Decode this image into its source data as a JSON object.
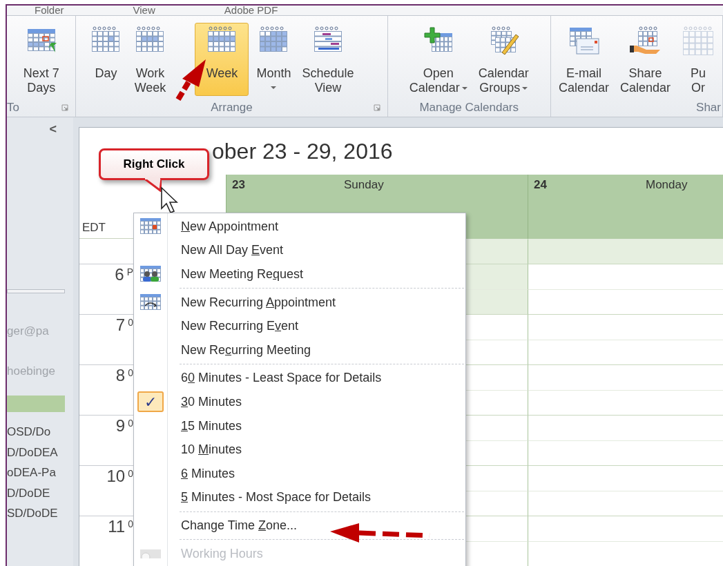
{
  "tabs": [
    {
      "label": "Folder"
    },
    {
      "label": "View"
    },
    {
      "label": "Adobe PDF"
    }
  ],
  "ribbon": {
    "groups": [
      {
        "label": "To",
        "launcher": true,
        "buttons": [
          {
            "lines": [
              "Next 7",
              "Days"
            ],
            "selected": false,
            "dropdown": false
          }
        ]
      },
      {
        "label": "Arrange",
        "launcher": true,
        "buttons": [
          {
            "lines": [
              "Day"
            ],
            "selected": false,
            "dropdown": false
          },
          {
            "lines": [
              "Work",
              "Week"
            ],
            "selected": false,
            "dropdown": false
          },
          {
            "lines": [
              "Week"
            ],
            "selected": true,
            "dropdown": false
          },
          {
            "lines": [
              "Month"
            ],
            "selected": false,
            "dropdown": true
          },
          {
            "lines": [
              "Schedule",
              "View"
            ],
            "selected": false,
            "dropdown": false
          }
        ]
      },
      {
        "label": "Manage Calendars",
        "launcher": false,
        "buttons": [
          {
            "lines": [
              "Open",
              "Calendar"
            ],
            "selected": false,
            "dropdown": true
          },
          {
            "lines": [
              "Calendar",
              "Groups"
            ],
            "selected": false,
            "dropdown": true
          }
        ]
      },
      {
        "label": "Shar",
        "launcher": false,
        "buttons": [
          {
            "lines": [
              "E-mail",
              "Calendar"
            ],
            "selected": false,
            "dropdown": false
          },
          {
            "lines": [
              "Share",
              "Calendar"
            ],
            "selected": false,
            "dropdown": false
          },
          {
            "lines": [
              "Pu",
              "Or"
            ],
            "selected": false,
            "dropdown": false
          }
        ]
      }
    ]
  },
  "sidebar": {
    "collapse": "<",
    "items": [
      {
        "kind": "faded",
        "text": "ger@pa"
      },
      {
        "kind": "faded",
        "text": "hoebinge"
      },
      {
        "kind": "highlight"
      },
      {
        "kind": "folder",
        "text": "OSD/Do"
      },
      {
        "kind": "folder",
        "text": "D/DoDEA"
      },
      {
        "kind": "folder",
        "text": "oDEA-Pa"
      },
      {
        "kind": "folder",
        "text": "D/DoDE"
      },
      {
        "kind": "folder",
        "text": "SD/DoDE"
      }
    ]
  },
  "calendar": {
    "title": "ober 23 - 29, 2016",
    "timezone": "EDT",
    "days": [
      {
        "number": "23",
        "name": "Sunday"
      },
      {
        "number": "24",
        "name": "Monday"
      }
    ],
    "slots": [
      {
        "shaded": [
          true,
          true
        ]
      },
      {
        "hour": "6",
        "sup": "P",
        "shaded": [
          true,
          false
        ]
      },
      {
        "shaded": [
          true,
          false
        ]
      },
      {
        "hour": "7",
        "sup": "0",
        "shaded": [
          false,
          false
        ]
      },
      {
        "shaded": [
          false,
          false
        ]
      },
      {
        "hour": "8",
        "sup": "0",
        "shaded": [
          false,
          false
        ]
      },
      {
        "shaded": [
          false,
          false
        ]
      },
      {
        "hour": "9",
        "sup": "0",
        "shaded": [
          false,
          false
        ]
      },
      {
        "shaded": [
          false,
          false
        ]
      },
      {
        "hour": "10",
        "sup": "0",
        "shaded": [
          false,
          false
        ]
      },
      {
        "shaded": [
          false,
          false
        ]
      },
      {
        "hour": "11",
        "sup": "0",
        "shaded": [
          false,
          false
        ]
      },
      {
        "shaded": [
          false,
          false
        ]
      }
    ]
  },
  "callout": {
    "text": "Right Click"
  },
  "context_menu": {
    "check_mark": "✓",
    "items": [
      {
        "kind": "item",
        "label": {
          "key": "N",
          "post": "ew Appointment"
        },
        "checked": false,
        "disabled": false
      },
      {
        "kind": "item",
        "label": {
          "pre": "New All Day ",
          "key": "E",
          "post": "vent"
        },
        "checked": false,
        "disabled": false
      },
      {
        "kind": "item",
        "label": {
          "pre": "New Meeting Re",
          "key": "q",
          "post": "uest"
        },
        "checked": false,
        "disabled": false
      },
      {
        "kind": "separator"
      },
      {
        "kind": "item",
        "label": {
          "pre": "New Recurring ",
          "key": "A",
          "post": "ppointment"
        },
        "checked": false,
        "disabled": false
      },
      {
        "kind": "item",
        "label": {
          "pre": "New Recurring E",
          "key": "v",
          "post": "ent"
        },
        "checked": false,
        "disabled": false
      },
      {
        "kind": "item",
        "label": {
          "pre": "New Re",
          "key": "c",
          "post": "urring Meeting"
        },
        "checked": false,
        "disabled": false
      },
      {
        "kind": "separator"
      },
      {
        "kind": "item",
        "label": {
          "pre": "6",
          "key": "0",
          "post": " Minutes - Least Space for Details"
        },
        "checked": false,
        "disabled": false
      },
      {
        "kind": "item",
        "label": {
          "key": "3",
          "post": "0 Minutes"
        },
        "checked": true,
        "disabled": false
      },
      {
        "kind": "item",
        "label": {
          "key": "1",
          "post": "5 Minutes"
        },
        "checked": false,
        "disabled": false
      },
      {
        "kind": "item",
        "label": {
          "pre": "10 ",
          "key": "M",
          "post": "inutes"
        },
        "checked": false,
        "disabled": false
      },
      {
        "kind": "item",
        "label": {
          "key": "6",
          "post": " Minutes"
        },
        "checked": false,
        "disabled": false
      },
      {
        "kind": "item",
        "label": {
          "key": "5",
          "post": " Minutes - Most Space for Details"
        },
        "checked": false,
        "disabled": false
      },
      {
        "kind": "separator"
      },
      {
        "kind": "item",
        "label": {
          "pre": "Change Time ",
          "key": "Z",
          "post": "one..."
        },
        "checked": false,
        "disabled": false
      },
      {
        "kind": "separator"
      },
      {
        "kind": "item",
        "label": {
          "pre": "Working Hours"
        },
        "checked": false,
        "disabled": true
      }
    ]
  }
}
